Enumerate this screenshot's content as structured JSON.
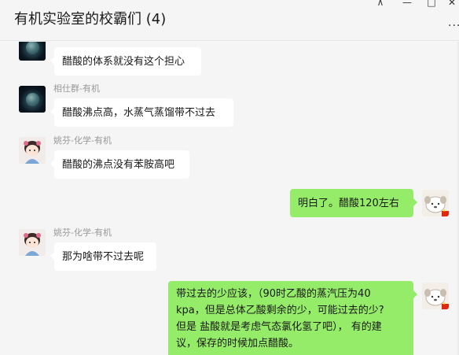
{
  "window": {
    "title": "有机实验室的校霸们 (4)",
    "controls": {
      "pin": "⊼",
      "minimize": "—",
      "maximize": "□",
      "close": "✕"
    },
    "more": "···"
  },
  "messages": [
    {
      "sender": "",
      "text": "醋酸的体系就没有这个担心",
      "direction": "incoming",
      "avatar": "earth-avatar"
    },
    {
      "sender": "相仕群-有机",
      "text": "醋酸沸点高，水蒸气蒸馏带不过去",
      "direction": "incoming",
      "avatar": "earth-avatar"
    },
    {
      "sender": "姚芬-化学-有机",
      "text": "醋酸的沸点没有苯胺高吧",
      "direction": "incoming",
      "avatar": "girl-avatar"
    },
    {
      "sender": "",
      "text": "明白了。醋酸120左右",
      "direction": "outgoing",
      "avatar": "dog-avatar"
    },
    {
      "sender": "姚芬-化学-有机",
      "text": "那为啥带不过去呢",
      "direction": "incoming",
      "avatar": "girl-avatar"
    },
    {
      "sender": "",
      "text_lines": [
        "带过去的少应该，（90时乙酸的蒸汽压为40",
        "kpa，但是总体乙酸剩余的少，可能过去的少?",
        "但是 盐酸就是考虑气态氯化氢了吧），   有的建",
        "议，保存的时候加点醋酸。"
      ],
      "direction": "outgoing",
      "avatar": "dog-avatar"
    }
  ],
  "colors": {
    "background": "#f5f5f5",
    "incoming_bubble": "#ffffff",
    "outgoing_bubble": "#95ec69",
    "sender_name": "#999999"
  }
}
